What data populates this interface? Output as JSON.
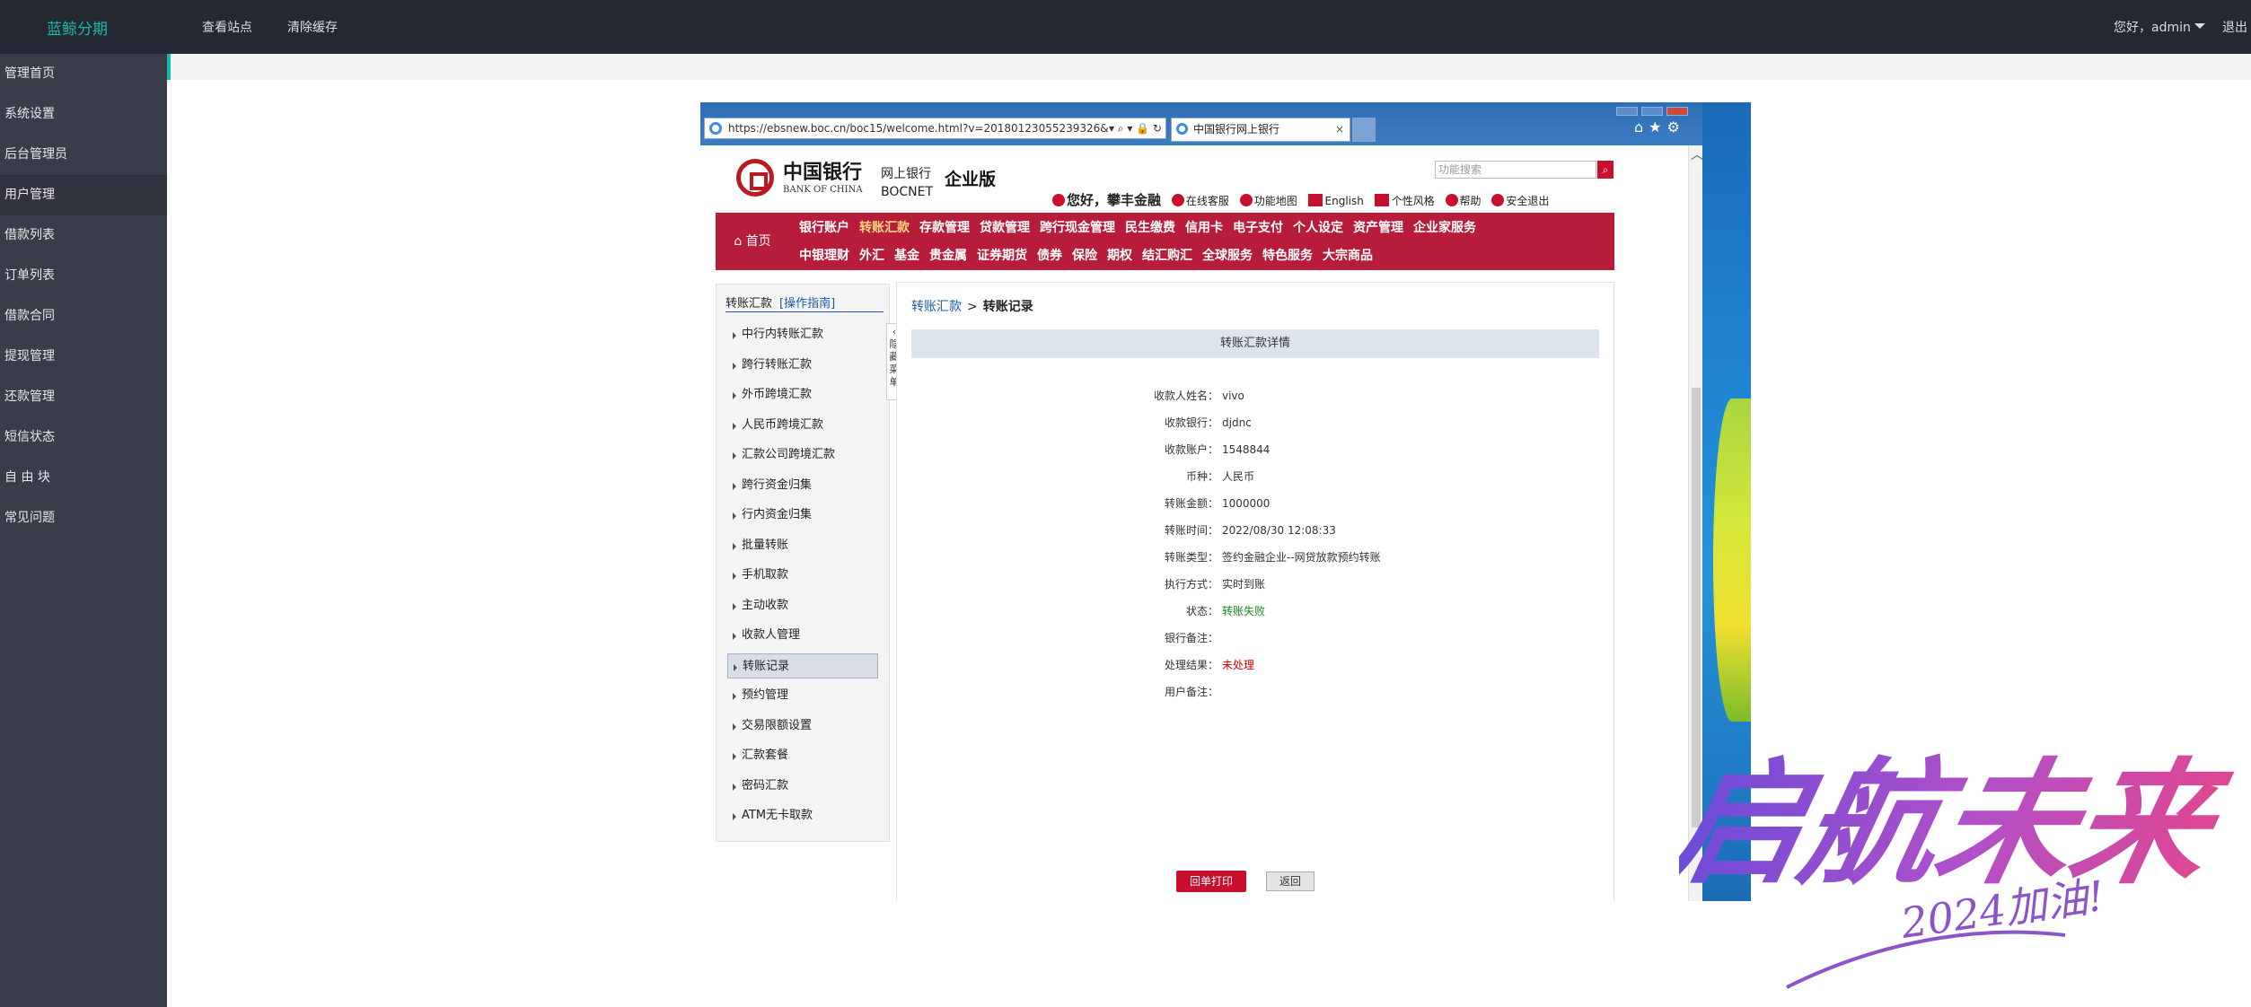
{
  "header": {
    "brand": "蓝鲸分期",
    "nav": [
      "查看站点",
      "清除缓存"
    ],
    "user": "您好，admin",
    "logout": "退出"
  },
  "sidebar": {
    "items": [
      {
        "label": "管理首页"
      },
      {
        "label": "系统设置"
      },
      {
        "label": "后台管理员"
      },
      {
        "label": "用户管理"
      },
      {
        "label": "借款列表"
      },
      {
        "label": "订单列表"
      },
      {
        "label": "借款合同"
      },
      {
        "label": "提现管理"
      },
      {
        "label": "还款管理"
      },
      {
        "label": "短信状态"
      },
      {
        "label": "自 由 块"
      },
      {
        "label": "常见问题"
      }
    ]
  },
  "browser": {
    "address": "https://ebsnew.boc.cn/boc15/welcome.html?v=20180123055239326&",
    "address_tools": "▾ ⌕ ▾ 🔒 ↻",
    "tab_title": "中国银行网上银行",
    "tab_close": "×"
  },
  "boc": {
    "logo_cn": "中国银行",
    "logo_en": "BANK OF CHINA",
    "net_cn": "网上银行",
    "net_en": "BOCNET",
    "edition": "企业版",
    "search_placeholder": "功能搜索",
    "hello": "您好，攀丰金融",
    "links": [
      "在线客服",
      "功能地图",
      "English",
      "个性风格",
      "帮助",
      "安全退出"
    ],
    "home": "首页",
    "nav_row1": [
      "银行账户",
      "转账汇款",
      "存款管理",
      "贷款管理",
      "跨行现金管理",
      "民生缴费",
      "信用卡",
      "电子支付",
      "个人设定",
      "资产管理",
      "企业家服务"
    ],
    "nav_row2": [
      "中银理财",
      "外汇",
      "基金",
      "贵金属",
      "证券期货",
      "债券",
      "保险",
      "期权",
      "结汇购汇",
      "全球服务",
      "特色服务",
      "大宗商品"
    ],
    "left_title": "转账汇款",
    "left_guide": "[操作指南]",
    "menu": [
      "中行内转账汇款",
      "跨行转账汇款",
      "外币跨境汇款",
      "人民币跨境汇款",
      "汇款公司跨境汇款",
      "跨行资金归集",
      "行内资金归集",
      "批量转账",
      "手机取款",
      "主动收款",
      "收款人管理",
      "转账记录",
      "预约管理",
      "交易限额设置",
      "汇款套餐",
      "密码汇款",
      "ATM无卡取款"
    ],
    "hide_menu": "‹ 隐藏菜单",
    "crumb_link": "转账汇款",
    "crumb_sep": ">",
    "crumb_current": "转账记录",
    "detail_title": "转账汇款详情",
    "details": [
      {
        "label": "收款人姓名：",
        "value": "vivo"
      },
      {
        "label": "收款银行：",
        "value": "djdnc"
      },
      {
        "label": "收款账户：",
        "value": "1548844"
      },
      {
        "label": "币种：",
        "value": "人民币"
      },
      {
        "label": "转账金额：",
        "value": "1000000"
      },
      {
        "label": "转账时间：",
        "value": "2022/08/30 12:08:33"
      },
      {
        "label": "转账类型：",
        "value": "签约金融企业--网贷放款预约转账"
      },
      {
        "label": "执行方式：",
        "value": "实时到账"
      },
      {
        "label": "状态：",
        "value": "转账失败"
      },
      {
        "label": "银行备注：",
        "value": ""
      },
      {
        "label": "处理结果：",
        "value": "未处理"
      },
      {
        "label": "用户备注：",
        "value": ""
      }
    ],
    "print_btn": "回单打印",
    "back_btn": "返回"
  },
  "watermark": {
    "text1": "启航未来",
    "text2": "2024加油!"
  }
}
